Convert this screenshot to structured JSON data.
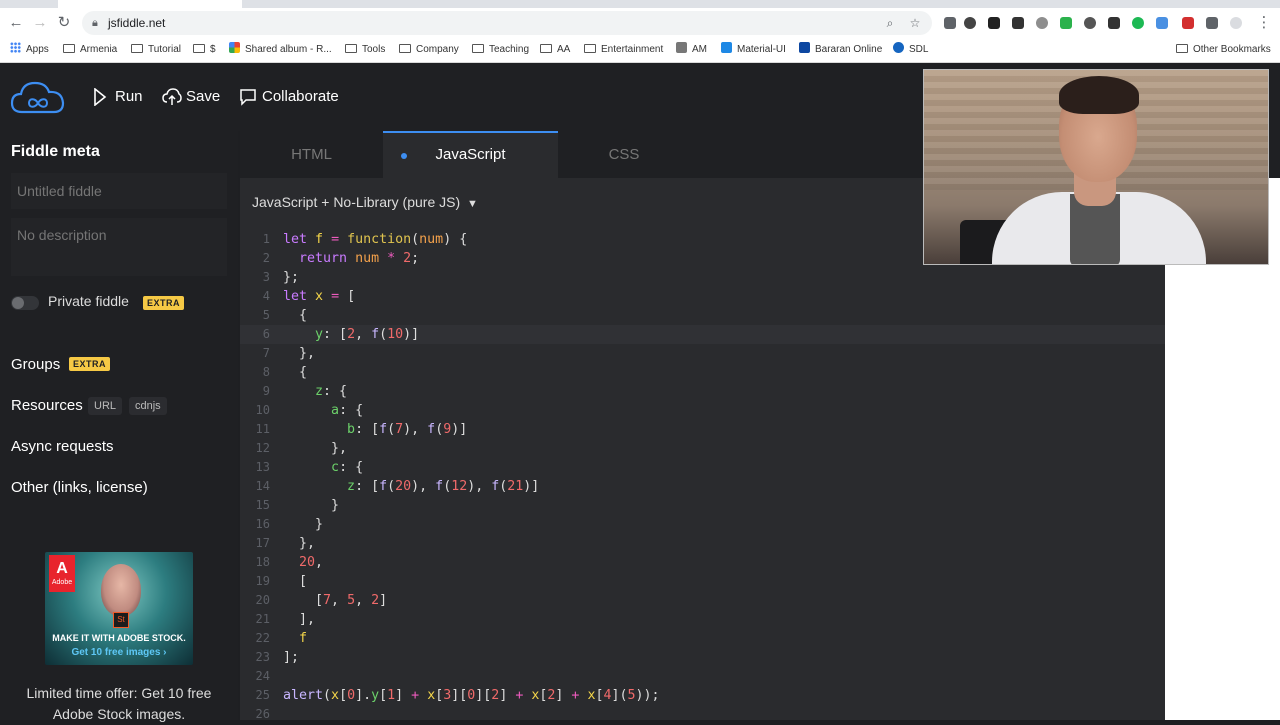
{
  "browser": {
    "url": "jsfiddle.net",
    "bookmarks": [
      "Apps",
      "Armenia",
      "Tutorial",
      "$",
      "Shared album - R...",
      "Tools",
      "Company",
      "Teaching",
      "AA",
      "Entertainment",
      "AM",
      "Material-UI",
      "Bararan Online",
      "SDL"
    ],
    "other_bookmarks": "Other Bookmarks"
  },
  "header": {
    "run_label": "Run",
    "save_label": "Save",
    "collaborate_label": "Collaborate"
  },
  "sidebar": {
    "meta_title": "Fiddle meta",
    "title_placeholder": "Untitled fiddle",
    "description_placeholder": "No description",
    "private_label": "Private fiddle",
    "extra_badge": "EXTRA",
    "groups_label": "Groups",
    "groups_badge": "EXTRA",
    "resources_label": "Resources",
    "resources_badges": [
      "URL",
      "cdnjs"
    ],
    "async_label": "Async requests",
    "other_label": "Other (links, license)",
    "ad": {
      "brand": "Adobe",
      "headline": "MAKE IT WITH ADOBE STOCK.",
      "cta": "Get 10 free images ›",
      "caption": "Limited time offer: Get 10 free Adobe Stock images."
    }
  },
  "editor": {
    "tabs": [
      "HTML",
      "JavaScript",
      "CSS"
    ],
    "active_tab": "JavaScript",
    "library": "JavaScript + No-Library (pure JS)",
    "current_line": 6,
    "lines": [
      {
        "n": 1,
        "text": "let f = function(num) {"
      },
      {
        "n": 2,
        "text": "  return num * 2;"
      },
      {
        "n": 3,
        "text": "};"
      },
      {
        "n": 4,
        "text": "let x = ["
      },
      {
        "n": 5,
        "text": "  {"
      },
      {
        "n": 6,
        "text": "    y: [2, f(10)]"
      },
      {
        "n": 7,
        "text": "  },"
      },
      {
        "n": 8,
        "text": "  {"
      },
      {
        "n": 9,
        "text": "    z: {"
      },
      {
        "n": 10,
        "text": "      a: {"
      },
      {
        "n": 11,
        "text": "        b: [f(7), f(9)]"
      },
      {
        "n": 12,
        "text": "      },"
      },
      {
        "n": 13,
        "text": "      c: {"
      },
      {
        "n": 14,
        "text": "        z: [f(20), f(12), f(21)]"
      },
      {
        "n": 15,
        "text": "      }"
      },
      {
        "n": 16,
        "text": "    }"
      },
      {
        "n": 17,
        "text": "  },"
      },
      {
        "n": 18,
        "text": "  20,"
      },
      {
        "n": 19,
        "text": "  ["
      },
      {
        "n": 20,
        "text": "    [7, 5, 2]"
      },
      {
        "n": 21,
        "text": "  ],"
      },
      {
        "n": 22,
        "text": "  f"
      },
      {
        "n": 23,
        "text": "];"
      },
      {
        "n": 24,
        "text": ""
      },
      {
        "n": 25,
        "text": "alert(x[0].y[1] + x[3][0][2] + x[2] + x[4](5));"
      },
      {
        "n": 26,
        "text": ""
      }
    ]
  },
  "colors": {
    "accent": "#3d8ef2",
    "extra_badge": "#f6c945",
    "editor_bg": "#2a2b2e",
    "sidebar_bg": "#1f2023"
  }
}
